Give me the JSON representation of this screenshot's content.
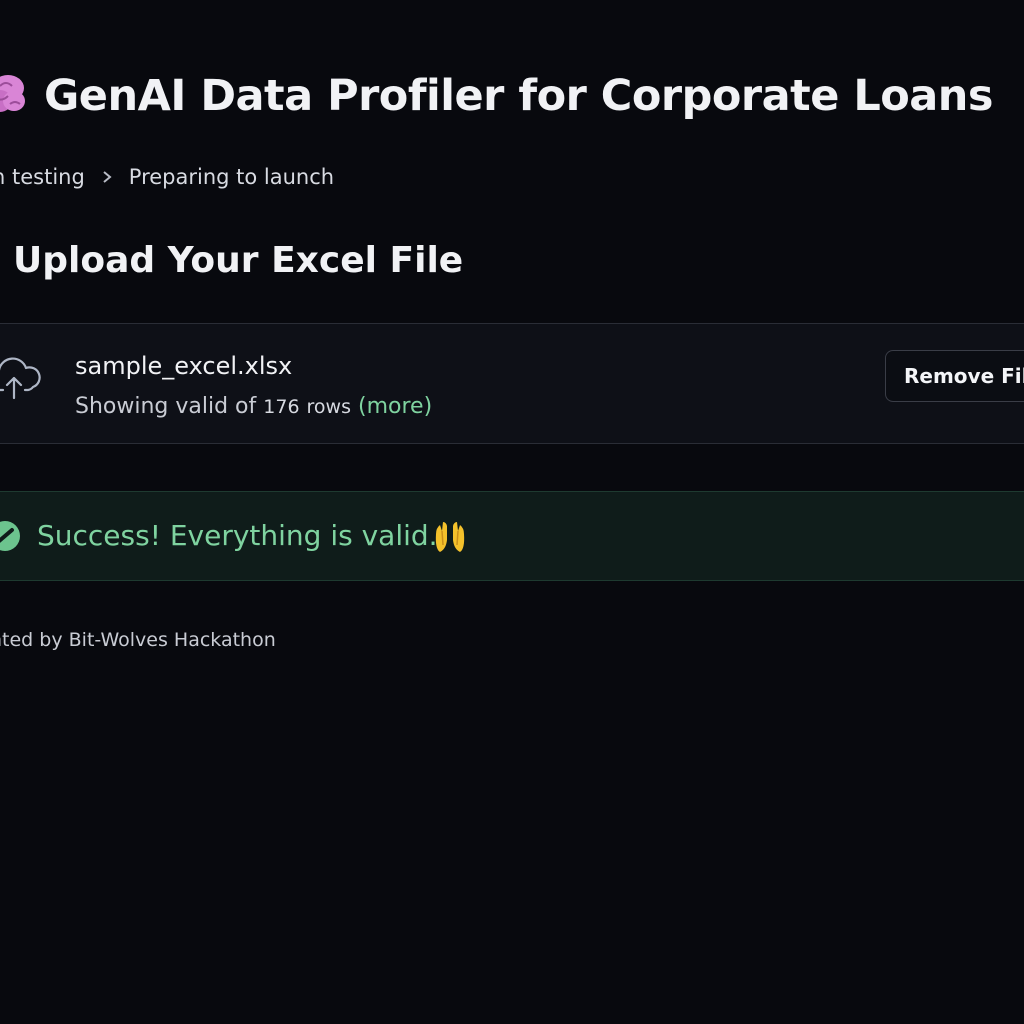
{
  "header": {
    "title": "GenAI Data Profiler for Corporate Loans",
    "icon": "brain-icon"
  },
  "breadcrumb": {
    "items": [
      "n testing",
      "Preparing to launch"
    ]
  },
  "upload_section": {
    "heading": "Upload Your Excel File",
    "file": {
      "name": "sample_excel.xlsx",
      "meta_prefix": "Showing valid of",
      "row_count": "176",
      "row_unit": "rows",
      "more_label": "(more)"
    },
    "remove_button_label": "Remove File",
    "icon": "cloud-upload-icon"
  },
  "status": {
    "message": "Success! Everything is valid.",
    "icon": "check-circle-icon",
    "emoji": "raising-hands-icon"
  },
  "footer": {
    "text": "nted by Bit-Wolves Hackathon"
  },
  "colors": {
    "background": "#08090e",
    "success_text": "#7fd3a0",
    "success_bg": "#0f1c1a",
    "brain_icon": "#d985d6"
  }
}
